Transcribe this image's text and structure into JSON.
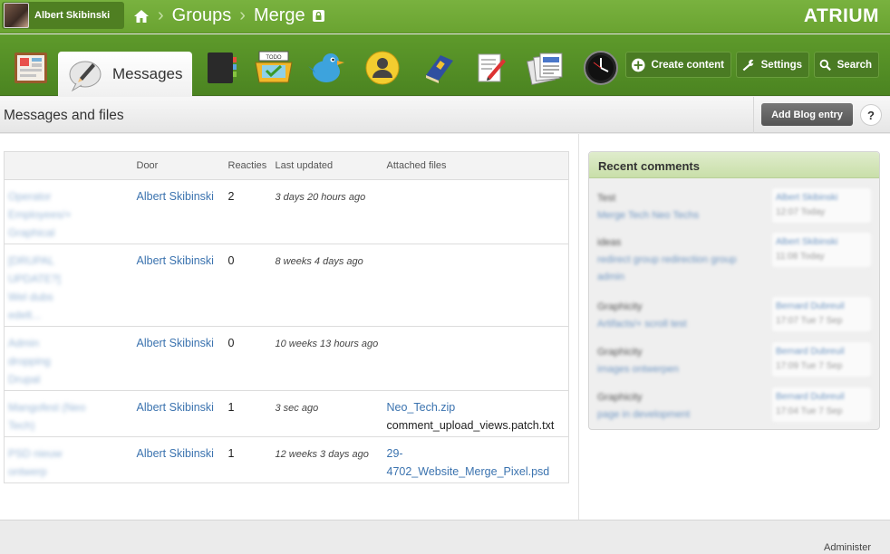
{
  "topbar": {
    "user_name": "Albert Skibinski",
    "breadcrumb": [
      "Groups",
      "Merge"
    ],
    "brand": "ATRIUM"
  },
  "icons": [
    "dashboard-icon",
    "messages-icon",
    "notebook-icon",
    "todo-icon",
    "twitter-bird-icon",
    "profile-icon",
    "book-icon",
    "write-icon",
    "documents-icon",
    "clock-icon"
  ],
  "tabs": {
    "active_label": "Messages"
  },
  "actions": {
    "create": "Create content",
    "settings": "Settings",
    "search": "Search"
  },
  "page": {
    "title": "Messages and files",
    "add_blog": "Add Blog entry",
    "help": "?"
  },
  "table": {
    "headers": [
      "",
      "Door",
      "Reacties",
      "Last updated",
      "Attached files"
    ],
    "rows": [
      {
        "title_lines": [
          "Operator",
          "Employees/+",
          "Graphical"
        ],
        "author": "Albert Skibinski",
        "count": "2",
        "updated": "3 days 20 hours ago",
        "files": []
      },
      {
        "title_lines": [
          "[DRUPAL",
          "UPDATE?]",
          "Wel dubs",
          "edelt..."
        ],
        "author": "Albert Skibinski",
        "count": "0",
        "updated": "8 weeks 4 days ago",
        "files": []
      },
      {
        "title_lines": [
          "Admin",
          "dropping",
          "Drupal"
        ],
        "author": "Albert Skibinski",
        "count": "0",
        "updated": "10 weeks 13 hours ago",
        "files": []
      },
      {
        "title_lines": [
          "Mangofest (Neo",
          "Tech)"
        ],
        "author": "Albert Skibinski",
        "count": "1",
        "updated": "3 sec ago",
        "files": [
          "Neo_Tech.zip",
          "comment_upload_views.patch.txt"
        ]
      },
      {
        "title_lines": [
          "PSD nieuw",
          "ontwerp"
        ],
        "author": "Albert Skibinski",
        "count": "1",
        "updated": "12 weeks 3 days ago",
        "files": [
          "29-",
          "4702_Website_Merge_Pixel.psd"
        ]
      }
    ]
  },
  "recent": {
    "title": "Recent comments",
    "items": [
      {
        "text": "Test",
        "link": "Merge Tech Neo Techs",
        "author": "Albert Skibinski",
        "date": "12:07 Today"
      },
      {
        "text": "ideas",
        "link": "redirect group redirection group",
        "link2": "admin",
        "author": "Albert Skibinski",
        "date": "11:08 Today"
      },
      {
        "text": "Graphicity",
        "link": "Artifacts/+ scroll test",
        "author": "Bernard Dubreuil",
        "date": "17:07 Tue 7 Sep"
      },
      {
        "text": "Graphicity",
        "link": "images ontwerpen",
        "author": "Bernard Dubreuil",
        "date": "17:09 Tue 7 Sep"
      },
      {
        "text": "Graphicity",
        "link": "page in development",
        "author": "Bernard Dubreuil",
        "date": "17:04 Tue 7 Sep"
      }
    ]
  },
  "footer": {
    "administer": "Administer"
  }
}
